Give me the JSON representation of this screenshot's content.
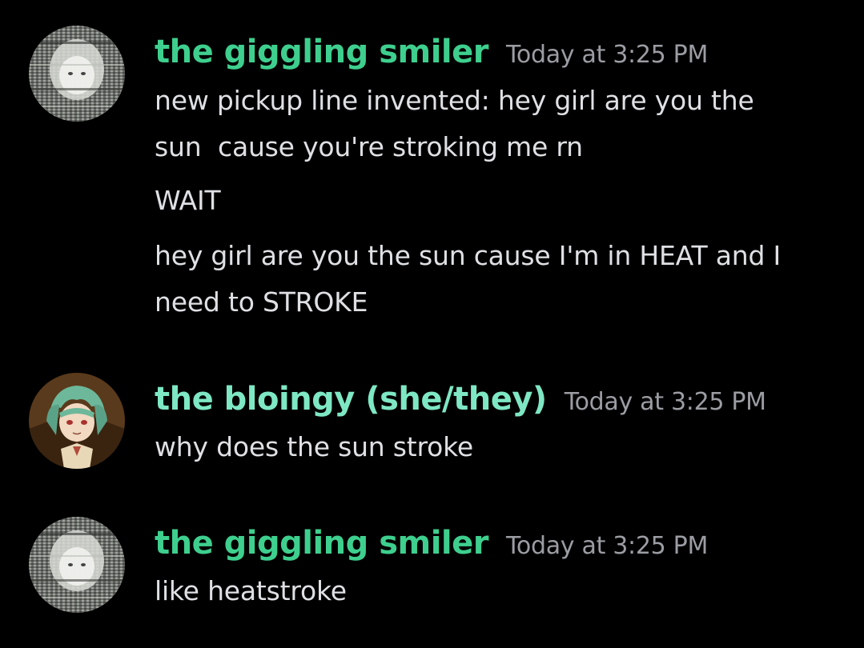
{
  "colors": {
    "background": "#000000",
    "username_smiler": "#3ecf8e",
    "username_bloingy": "#7ee7c3",
    "timestamp": "#9b9da3",
    "message_text": "#dfe0e4"
  },
  "messages": [
    {
      "author": "the giggling smiler",
      "avatar": "glitchy-character-avatar",
      "timestamp": "Today at 3:25 PM",
      "lines": [
        "new pickup line invented: hey girl are you the",
        "sun  cause you're stroking me rn",
        "WAIT",
        "hey girl are you the sun cause I'm in HEAT and I",
        "need to STROKE"
      ]
    },
    {
      "author": "the bloingy (she/they)",
      "avatar": "green-haired-character-avatar",
      "timestamp": "Today at 3:25 PM",
      "lines": [
        "why does the sun stroke"
      ]
    },
    {
      "author": "the giggling smiler",
      "avatar": "glitchy-character-avatar",
      "timestamp": "Today at 3:25 PM",
      "lines": [
        "like heatstroke"
      ]
    }
  ]
}
